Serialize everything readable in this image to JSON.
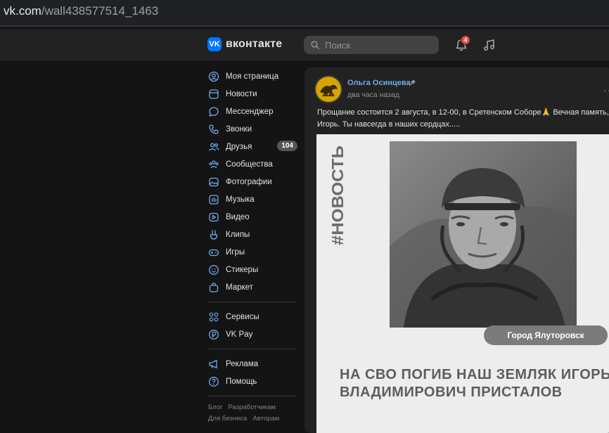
{
  "browser": {
    "url_host": "vk.com",
    "url_path": "/wall438577514_1463"
  },
  "header": {
    "logo_text": "вконтакте",
    "search_placeholder": "Поиск",
    "notifications_count": "4"
  },
  "sidebar": {
    "items": [
      {
        "label": "Моя страница",
        "icon": "user-circle-icon"
      },
      {
        "label": "Новости",
        "icon": "newspaper-icon"
      },
      {
        "label": "Мессенджер",
        "icon": "chat-bubble-icon"
      },
      {
        "label": "Звонки",
        "icon": "phone-icon"
      },
      {
        "label": "Друзья",
        "icon": "friends-icon",
        "count": "104"
      },
      {
        "label": "Сообщества",
        "icon": "communities-icon"
      },
      {
        "label": "Фотографии",
        "icon": "photo-icon"
      },
      {
        "label": "Музыка",
        "icon": "music-icon"
      },
      {
        "label": "Видео",
        "icon": "video-icon"
      },
      {
        "label": "Клипы",
        "icon": "clips-icon"
      },
      {
        "label": "Игры",
        "icon": "gamepad-icon"
      },
      {
        "label": "Стикеры",
        "icon": "sticker-icon"
      },
      {
        "label": "Маркет",
        "icon": "shopping-bag-icon"
      }
    ],
    "items2": [
      {
        "label": "Сервисы",
        "icon": "services-grid-icon"
      },
      {
        "label": "VK Pay",
        "icon": "vkpay-icon"
      }
    ],
    "items3": [
      {
        "label": "Реклама",
        "icon": "megaphone-icon"
      },
      {
        "label": "Помощь",
        "icon": "help-icon"
      }
    ],
    "footer": [
      "Блог",
      "Разработчикам",
      "Для бизнеса",
      "Авторам"
    ]
  },
  "post": {
    "author": "Ольга Осинцева",
    "time": "два часа назад",
    "text": "Прощание состоится 2 августа, в 12-00, в Сретенском Соборе🙏 Вечная память, Игорь. Ты навсегда в наших сердцах.....",
    "image": {
      "tag": "#НОВОСТЬ",
      "location": "Город Ялуторовск",
      "headline": "НА СВО ПОГИБ НАШ ЗЕМЛЯК ИГОРЬ ВЛАДИМИРОВИЧ ПРИСТАЛОВ"
    }
  },
  "colors": {
    "accent": "#0077ff",
    "link": "#71aaeb",
    "badge": "#e64646",
    "background": "#141414",
    "panel": "#222222"
  }
}
